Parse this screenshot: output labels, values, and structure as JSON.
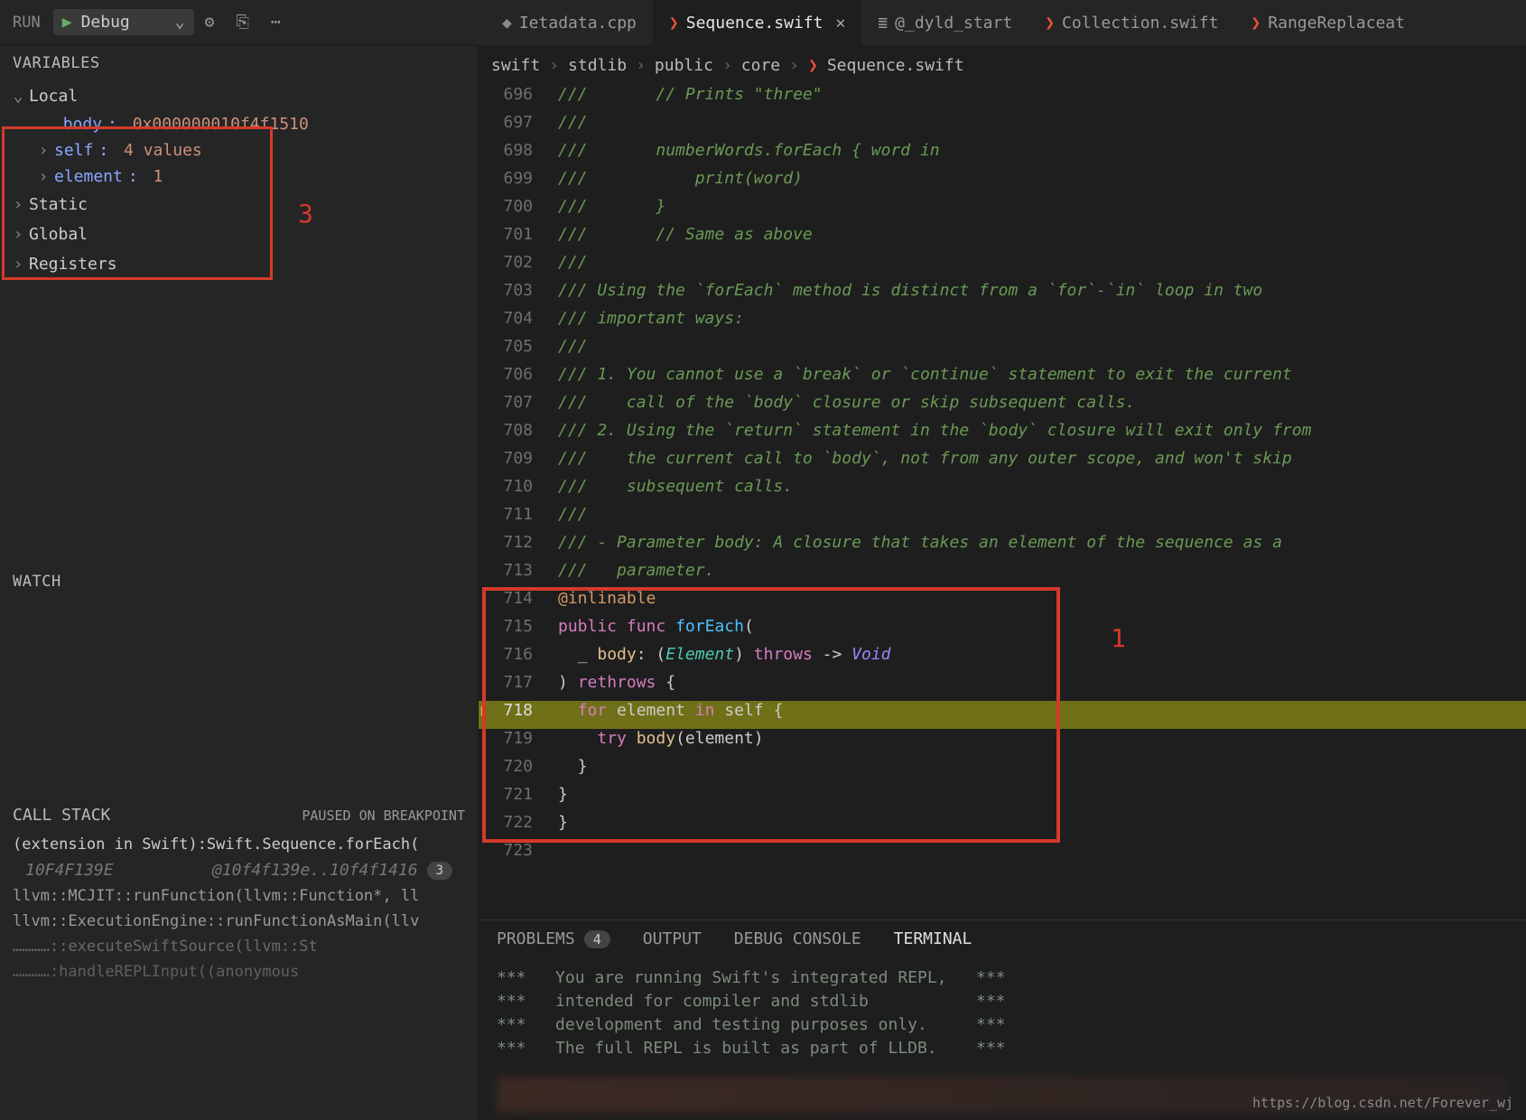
{
  "toolbar": {
    "run_label": "RUN",
    "config": "Debug"
  },
  "tabs": [
    {
      "icon": "cpp",
      "label": "Ietadata.cpp",
      "active": false
    },
    {
      "icon": "swift",
      "label": "Sequence.swift",
      "active": true,
      "closable": true
    },
    {
      "icon": "asm",
      "label": "@_dyld_start",
      "active": false
    },
    {
      "icon": "swift",
      "label": "Collection.swift",
      "active": false
    },
    {
      "icon": "swift",
      "label": "RangeReplaceat",
      "active": false
    }
  ],
  "crumbs": [
    "swift",
    "stdlib",
    "public",
    "core",
    "Sequence.swift"
  ],
  "variables": {
    "title": "VARIABLES",
    "scopes": {
      "local": {
        "label": "Local",
        "items": [
          {
            "name": "body",
            "value": "0x000000010f4f1510"
          },
          {
            "name": "self",
            "value": "4 values"
          },
          {
            "name": "element",
            "value": "1"
          }
        ]
      },
      "static": {
        "label": "Static"
      },
      "global": {
        "label": "Global"
      },
      "registers": {
        "label": "Registers"
      }
    },
    "annotation_label": "3"
  },
  "watch": {
    "title": "WATCH"
  },
  "callstack": {
    "title": "CALL STACK",
    "status": "PAUSED ON BREAKPOINT",
    "frames": [
      {
        "text": "(extension in Swift):Swift.Sequence.forEach("
      },
      {
        "addr": "10F4F139E",
        "range": "@10f4f139e..10f4f1416",
        "badge": "3"
      },
      {
        "text": "llvm::MCJIT::runFunction(llvm::Function*, ll"
      },
      {
        "text": "llvm::ExecutionEngine::runFunctionAsMain(llv"
      },
      {
        "text": "…………::executeSwiftSource(llvm::St"
      },
      {
        "text": "…………:handleREPLInput((anonymous"
      }
    ]
  },
  "code": {
    "first_line": 696,
    "highlight_line": 718,
    "annotation_label": "1",
    "lines": [
      "///       // Prints \"three\"",
      "///",
      "///       numberWords.forEach { word in",
      "///           print(word)",
      "///       }",
      "///       // Same as above",
      "///",
      "/// Using the `forEach` method is distinct from a `for`-`in` loop in two",
      "/// important ways:",
      "///",
      "/// 1. You cannot use a `break` or `continue` statement to exit the current",
      "///    call of the `body` closure or skip subsequent calls.",
      "/// 2. Using the `return` statement in the `body` closure will exit only from",
      "///    the current call to `body`, not from any outer scope, and won't skip",
      "///    subsequent calls.",
      "///",
      "/// - Parameter body: A closure that takes an element of the sequence as a",
      "///   parameter.",
      "@inlinable",
      "public func forEach(",
      "  _ body: (Element) throws -> Void",
      ") rethrows {",
      "  for element in self {",
      "    try body(element)",
      "  }",
      "}",
      "}",
      ""
    ]
  },
  "panel": {
    "tabs": {
      "problems": "PROBLEMS",
      "problems_count": "4",
      "output": "OUTPUT",
      "debug": "DEBUG CONSOLE",
      "terminal": "TERMINAL"
    },
    "terminal_lines": [
      "***   You are running Swift's integrated REPL,   ***",
      "***   intended for compiler and stdlib           ***",
      "***   development and testing purposes only.     ***",
      "***   The full REPL is built as part of LLDB.    ***"
    ]
  },
  "footer_url": "https://blog.csdn.net/Forever_wj"
}
